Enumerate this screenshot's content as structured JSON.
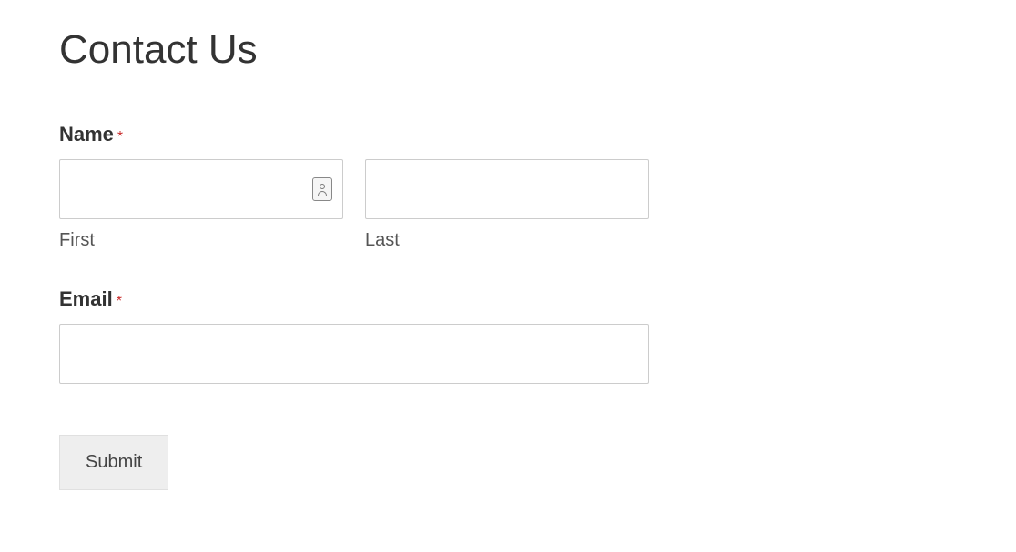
{
  "page": {
    "title": "Contact Us"
  },
  "form": {
    "name": {
      "label": "Name",
      "required_mark": "*",
      "first_sublabel": "First",
      "last_sublabel": "Last",
      "first_value": "",
      "last_value": ""
    },
    "email": {
      "label": "Email",
      "required_mark": "*",
      "value": ""
    },
    "submit": {
      "label": "Submit"
    }
  }
}
